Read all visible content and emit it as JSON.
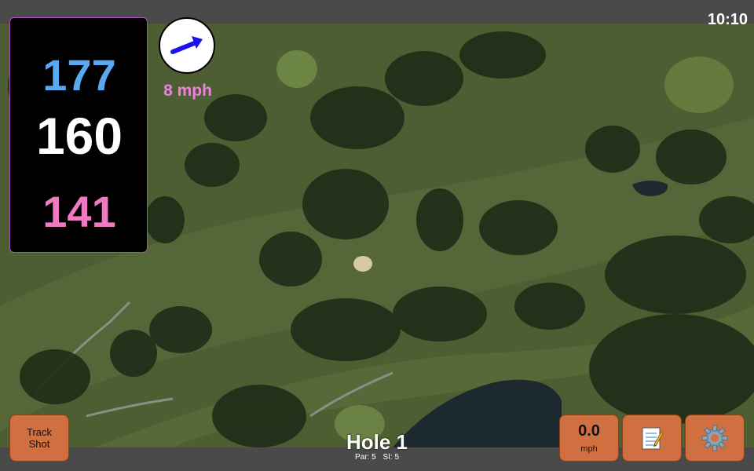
{
  "status_bar": {
    "clock": "10:10"
  },
  "distances": {
    "back": "177",
    "middle": "160",
    "front": "141",
    "colors": {
      "back": "#5aa8ef",
      "middle": "#ffffff",
      "front": "#f07ac2"
    }
  },
  "wind": {
    "direction_icon": "wind-arrow-icon",
    "speed_label": "8 mph",
    "speed_color": "#f080e0",
    "arrow_color": "#1a10f0"
  },
  "buttons": {
    "track_shot": "Track\nShot",
    "player_wind_value": "0.0",
    "player_wind_unit": "mph",
    "notes_icon": "notepad-icon",
    "settings_icon": "gear-icon",
    "button_color": "#d07040"
  },
  "hole": {
    "title": "Hole 1",
    "par_label": "Par: 5",
    "si_label": "SI: 5"
  }
}
